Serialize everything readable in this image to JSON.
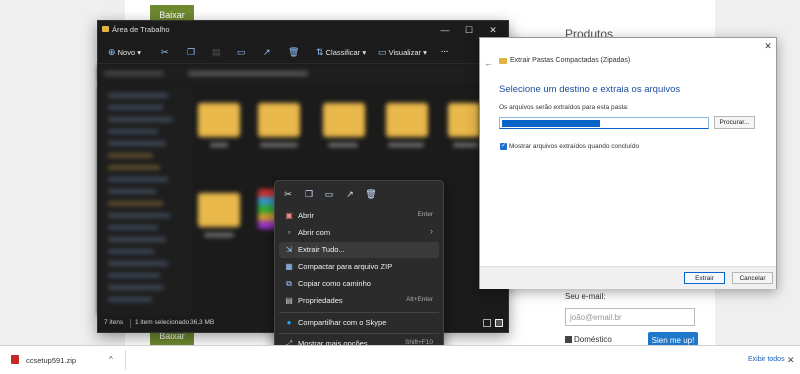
{
  "webpage": {
    "top_button_label": "Baixar",
    "bottom_button_label": "Baixar",
    "products_title": "Produtos",
    "email_label": "Seu e-mail:",
    "email_placeholder": "joão@email.br",
    "domestic_label": "Doméstico",
    "signup_label": "Sien me up!"
  },
  "explorer": {
    "title": "Área de Trabalho",
    "window_controls": [
      "—",
      "☐",
      "✕"
    ],
    "toolbar": {
      "new_label": "Novo",
      "sort_label": "Classificar",
      "view_label": "Visualizar",
      "more_label": "···"
    },
    "status": {
      "items": "7 itens",
      "selected": "1 item selecionado",
      "size": "36,3 MB"
    }
  },
  "context_menu": {
    "items": [
      {
        "label": "Abrir",
        "shortcut": "Enter",
        "icon": "open-icon"
      },
      {
        "label": "Abrir com",
        "shortcut": "›",
        "icon": "open-with-icon"
      },
      {
        "label": "Extrair Tudo...",
        "shortcut": "",
        "icon": "extract-icon"
      },
      {
        "label": "Compactar para arquivo ZIP",
        "shortcut": "",
        "icon": "zip-icon"
      },
      {
        "label": "Copiar como caminho",
        "shortcut": "",
        "icon": "copy-path-icon"
      },
      {
        "label": "Propriedades",
        "shortcut": "Alt+Enter",
        "icon": "properties-icon"
      },
      {
        "label": "Compartilhar com o Skype",
        "shortcut": "",
        "icon": "skype-icon"
      },
      {
        "label": "Mostrar mais opções",
        "shortcut": "Shift+F10",
        "icon": "more-options-icon"
      }
    ]
  },
  "dialog": {
    "title": "Extrair Pastas Compactadas (Zipadas)",
    "heading": "Selecione um destino e extraia os arquivos",
    "description": "Os arquivos serão extraídos para esta pasta:",
    "browse_label": "Procurar...",
    "checkbox_label": "Mostrar arquivos extraídos quando concluído",
    "checkbox_checked": true,
    "extract_label": "Extrair",
    "cancel_label": "Cancelar"
  },
  "download_bar": {
    "filename": "ccsetup591.zip",
    "show_all_label": "Exibir todos"
  }
}
